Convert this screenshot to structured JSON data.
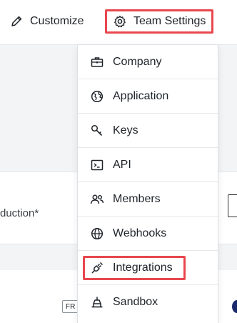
{
  "topbar": {
    "customize_label": "Customize",
    "team_settings_label": "Team Settings"
  },
  "background": {
    "field_label": "duction*",
    "badge_text": "FR"
  },
  "menu": {
    "items": [
      {
        "label": "Company",
        "icon": "briefcase-icon"
      },
      {
        "label": "Application",
        "icon": "globe-icon"
      },
      {
        "label": "Keys",
        "icon": "key-icon"
      },
      {
        "label": "API",
        "icon": "terminal-icon"
      },
      {
        "label": "Members",
        "icon": "members-icon"
      },
      {
        "label": "Webhooks",
        "icon": "globe-grid-icon"
      },
      {
        "label": "Integrations",
        "icon": "plug-icon"
      },
      {
        "label": "Sandbox",
        "icon": "sandbox-icon"
      }
    ]
  },
  "colors": {
    "highlight": "#e8474e",
    "text": "#1f2328",
    "panel_gray": "#f3f4f6"
  }
}
